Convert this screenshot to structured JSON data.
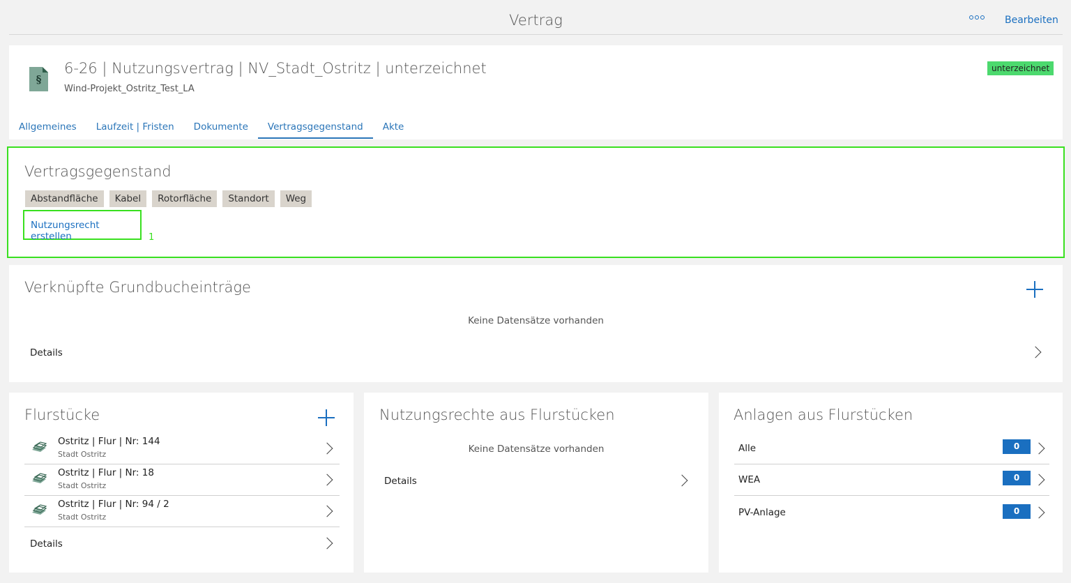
{
  "topbar": {
    "title": "Vertrag",
    "more_label": "ooo",
    "edit_label": "Bearbeiten"
  },
  "header": {
    "icon_symbol": "§",
    "title": "6-26 | Nutzungsvertrag | NV_Stadt_Ostritz | unterzeichnet",
    "subtitle": "Wind-Projekt_Ostritz_Test_LA",
    "status": "unterzeichnet",
    "status_color": "#4cd96e",
    "tabs": [
      {
        "label": "Allgemeines"
      },
      {
        "label": "Laufzeit | Fristen"
      },
      {
        "label": "Dokumente"
      },
      {
        "label": "Vertragsgegenstand",
        "active": true
      },
      {
        "label": "Akte"
      }
    ]
  },
  "vertragsgegenstand": {
    "title": "Vertragsgegenstand",
    "tags": [
      "Abstandfläche",
      "Kabel",
      "Rotorfläche",
      "Standort",
      "Weg"
    ],
    "create_link": "Nutzungsrecht erstellen",
    "marker": "1",
    "highlight_color": "#39e01f"
  },
  "grundbuch": {
    "title": "Verknüpfte Grundbucheinträge",
    "empty": "Keine Datensätze vorhanden",
    "details": "Details"
  },
  "flurstuecke": {
    "title": "Flurstücke",
    "items": [
      {
        "name": "Ostritz | Flur | Nr: 144",
        "sub": "Stadt Ostritz"
      },
      {
        "name": "Ostritz | Flur | Nr: 18",
        "sub": "Stadt Ostritz"
      },
      {
        "name": "Ostritz | Flur | Nr: 94 / 2",
        "sub": "Stadt Ostritz"
      }
    ],
    "details": "Details"
  },
  "nutzungsrechte": {
    "title": "Nutzungsrechte aus Flurstücken",
    "empty": "Keine Datensätze vorhanden",
    "details": "Details"
  },
  "anlagen": {
    "title": "Anlagen aus Flurstücken",
    "items": [
      {
        "label": "Alle",
        "count": "0"
      },
      {
        "label": "WEA",
        "count": "0"
      },
      {
        "label": "PV-Anlage",
        "count": "0"
      }
    ],
    "accent": "#1a6fc0"
  }
}
